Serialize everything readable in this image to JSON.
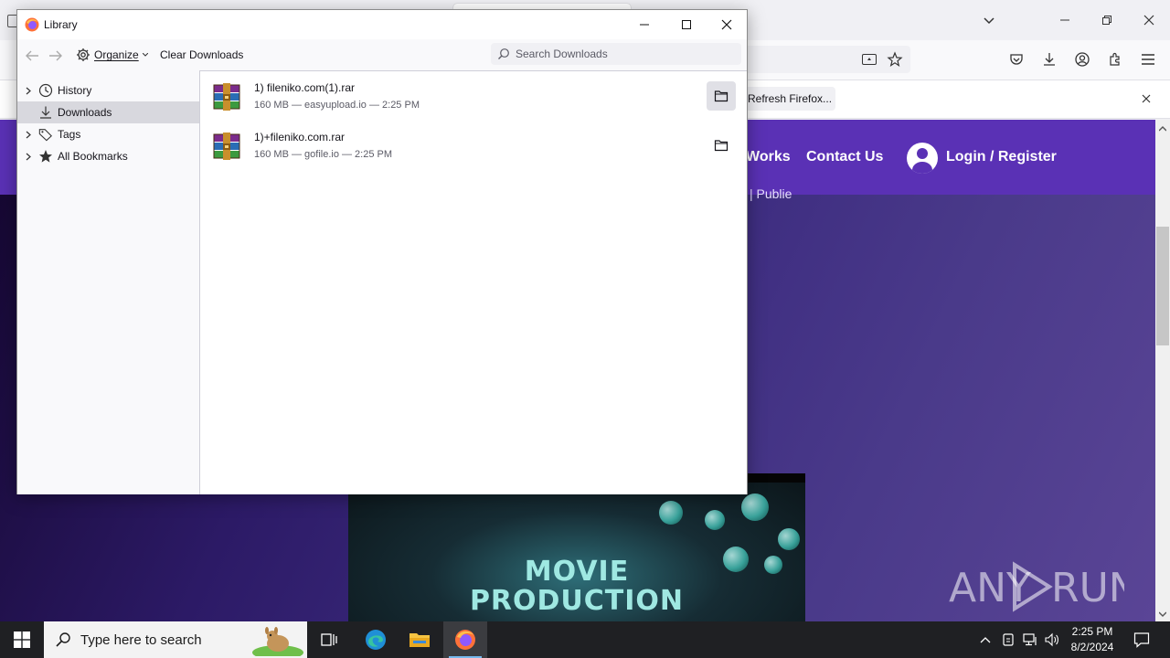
{
  "library": {
    "title": "Library",
    "toolbar": {
      "organize_label": "Organize",
      "clear_downloads_label": "Clear Downloads",
      "search_placeholder": "Search Downloads"
    },
    "sidebar": {
      "items": [
        {
          "label": "History",
          "icon": "clock-icon",
          "expandable": true,
          "selected": false
        },
        {
          "label": "Downloads",
          "icon": "download-icon",
          "expandable": false,
          "selected": true
        },
        {
          "label": "Tags",
          "icon": "tag-icon",
          "expandable": true,
          "selected": false
        },
        {
          "label": "All Bookmarks",
          "icon": "star-icon",
          "expandable": true,
          "selected": false
        }
      ]
    },
    "downloads": [
      {
        "name": "1) fileniko.com(1).rar",
        "meta": "160 MB — easyupload.io — 2:25 PM",
        "icon": "winrar-archive-icon"
      },
      {
        "name": "1)+fileniko.com.rar",
        "meta": "160 MB — gofile.io — 2:25 PM",
        "icon": "winrar-archive-icon"
      }
    ]
  },
  "browser": {
    "notification": {
      "refresh_button_label": "Refresh Firefox..."
    },
    "page": {
      "nav_links": [
        "Works",
        "Contact Us"
      ],
      "login_label": "Login / Register",
      "side_text": "| Publie",
      "video_title_lines": [
        "MOVIE",
        "PRODUCTION"
      ]
    },
    "watermark": "ANY RUN"
  },
  "taskbar": {
    "search_placeholder": "Type here to search",
    "clock_time": "2:25 PM",
    "clock_date": "8/2/2024"
  },
  "colors": {
    "page_header": "#5a31b5",
    "taskbar": "#1f2023",
    "selected_row": "#d8d8de"
  }
}
